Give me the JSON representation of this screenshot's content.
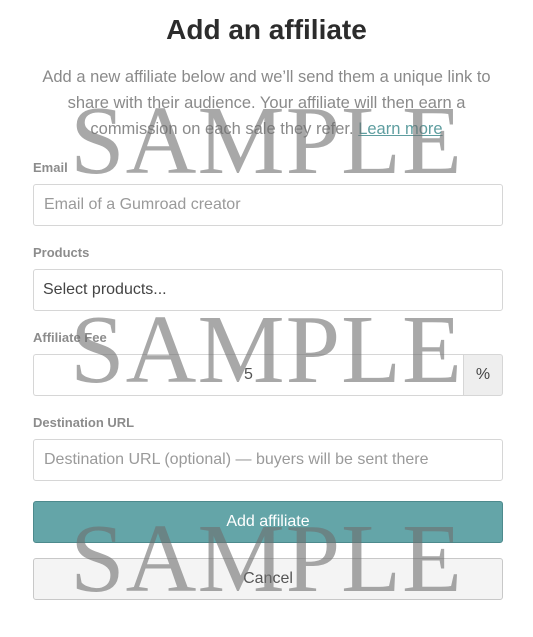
{
  "modal": {
    "title": "Add an affiliate",
    "description": "Add a new affiliate below and we’ll send them a unique link to share with their audience. Your affiliate will then earn a commission on each sale they refer.",
    "learn_more_label": "Learn more"
  },
  "email": {
    "label": "Email",
    "placeholder": "Email of a Gumroad creator",
    "value": ""
  },
  "products": {
    "label": "Products",
    "selected_text": "Select products..."
  },
  "fee": {
    "label": "Affiliate Fee",
    "value": "5",
    "suffix": "%"
  },
  "destination": {
    "label": "Destination URL",
    "placeholder": "Destination URL (optional) — buyers will be sent there",
    "value": ""
  },
  "actions": {
    "submit_label": "Add affiliate",
    "cancel_label": "Cancel"
  },
  "watermark": {
    "text": "SAMPLE",
    "color": "#6e6e6e"
  },
  "colors": {
    "accent": "#64a5a8",
    "link": "#5f9ea0"
  }
}
